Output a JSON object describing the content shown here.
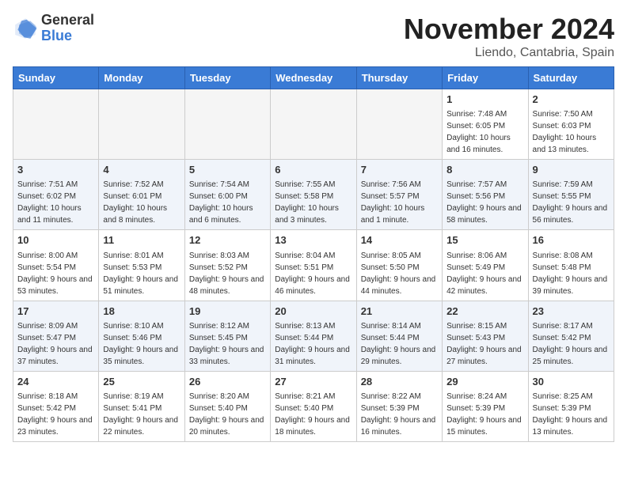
{
  "header": {
    "logo_general": "General",
    "logo_blue": "Blue",
    "month": "November 2024",
    "location": "Liendo, Cantabria, Spain"
  },
  "weekdays": [
    "Sunday",
    "Monday",
    "Tuesday",
    "Wednesday",
    "Thursday",
    "Friday",
    "Saturday"
  ],
  "weeks": [
    [
      {
        "day": "",
        "empty": true
      },
      {
        "day": "",
        "empty": true
      },
      {
        "day": "",
        "empty": true
      },
      {
        "day": "",
        "empty": true
      },
      {
        "day": "",
        "empty": true
      },
      {
        "day": "1",
        "sunrise": "7:48 AM",
        "sunset": "6:05 PM",
        "daylight": "10 hours and 16 minutes."
      },
      {
        "day": "2",
        "sunrise": "7:50 AM",
        "sunset": "6:03 PM",
        "daylight": "10 hours and 13 minutes."
      }
    ],
    [
      {
        "day": "3",
        "sunrise": "7:51 AM",
        "sunset": "6:02 PM",
        "daylight": "10 hours and 11 minutes."
      },
      {
        "day": "4",
        "sunrise": "7:52 AM",
        "sunset": "6:01 PM",
        "daylight": "10 hours and 8 minutes."
      },
      {
        "day": "5",
        "sunrise": "7:54 AM",
        "sunset": "6:00 PM",
        "daylight": "10 hours and 6 minutes."
      },
      {
        "day": "6",
        "sunrise": "7:55 AM",
        "sunset": "5:58 PM",
        "daylight": "10 hours and 3 minutes."
      },
      {
        "day": "7",
        "sunrise": "7:56 AM",
        "sunset": "5:57 PM",
        "daylight": "10 hours and 1 minute."
      },
      {
        "day": "8",
        "sunrise": "7:57 AM",
        "sunset": "5:56 PM",
        "daylight": "9 hours and 58 minutes."
      },
      {
        "day": "9",
        "sunrise": "7:59 AM",
        "sunset": "5:55 PM",
        "daylight": "9 hours and 56 minutes."
      }
    ],
    [
      {
        "day": "10",
        "sunrise": "8:00 AM",
        "sunset": "5:54 PM",
        "daylight": "9 hours and 53 minutes."
      },
      {
        "day": "11",
        "sunrise": "8:01 AM",
        "sunset": "5:53 PM",
        "daylight": "9 hours and 51 minutes."
      },
      {
        "day": "12",
        "sunrise": "8:03 AM",
        "sunset": "5:52 PM",
        "daylight": "9 hours and 48 minutes."
      },
      {
        "day": "13",
        "sunrise": "8:04 AM",
        "sunset": "5:51 PM",
        "daylight": "9 hours and 46 minutes."
      },
      {
        "day": "14",
        "sunrise": "8:05 AM",
        "sunset": "5:50 PM",
        "daylight": "9 hours and 44 minutes."
      },
      {
        "day": "15",
        "sunrise": "8:06 AM",
        "sunset": "5:49 PM",
        "daylight": "9 hours and 42 minutes."
      },
      {
        "day": "16",
        "sunrise": "8:08 AM",
        "sunset": "5:48 PM",
        "daylight": "9 hours and 39 minutes."
      }
    ],
    [
      {
        "day": "17",
        "sunrise": "8:09 AM",
        "sunset": "5:47 PM",
        "daylight": "9 hours and 37 minutes."
      },
      {
        "day": "18",
        "sunrise": "8:10 AM",
        "sunset": "5:46 PM",
        "daylight": "9 hours and 35 minutes."
      },
      {
        "day": "19",
        "sunrise": "8:12 AM",
        "sunset": "5:45 PM",
        "daylight": "9 hours and 33 minutes."
      },
      {
        "day": "20",
        "sunrise": "8:13 AM",
        "sunset": "5:44 PM",
        "daylight": "9 hours and 31 minutes."
      },
      {
        "day": "21",
        "sunrise": "8:14 AM",
        "sunset": "5:44 PM",
        "daylight": "9 hours and 29 minutes."
      },
      {
        "day": "22",
        "sunrise": "8:15 AM",
        "sunset": "5:43 PM",
        "daylight": "9 hours and 27 minutes."
      },
      {
        "day": "23",
        "sunrise": "8:17 AM",
        "sunset": "5:42 PM",
        "daylight": "9 hours and 25 minutes."
      }
    ],
    [
      {
        "day": "24",
        "sunrise": "8:18 AM",
        "sunset": "5:42 PM",
        "daylight": "9 hours and 23 minutes."
      },
      {
        "day": "25",
        "sunrise": "8:19 AM",
        "sunset": "5:41 PM",
        "daylight": "9 hours and 22 minutes."
      },
      {
        "day": "26",
        "sunrise": "8:20 AM",
        "sunset": "5:40 PM",
        "daylight": "9 hours and 20 minutes."
      },
      {
        "day": "27",
        "sunrise": "8:21 AM",
        "sunset": "5:40 PM",
        "daylight": "9 hours and 18 minutes."
      },
      {
        "day": "28",
        "sunrise": "8:22 AM",
        "sunset": "5:39 PM",
        "daylight": "9 hours and 16 minutes."
      },
      {
        "day": "29",
        "sunrise": "8:24 AM",
        "sunset": "5:39 PM",
        "daylight": "9 hours and 15 minutes."
      },
      {
        "day": "30",
        "sunrise": "8:25 AM",
        "sunset": "5:39 PM",
        "daylight": "9 hours and 13 minutes."
      }
    ]
  ]
}
